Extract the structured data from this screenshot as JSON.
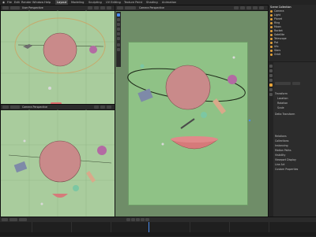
{
  "topbar": {
    "menu": [
      "File",
      "Edit",
      "Render",
      "Window",
      "Help"
    ],
    "workspace_tabs": [
      "Layout",
      "Modeling",
      "Sculpting",
      "UV Editing",
      "Texture Paint",
      "Shading",
      "Animation"
    ]
  },
  "viewports": {
    "top_left": {
      "label": "User Perspective"
    },
    "bottom_left": {
      "label": "Camera Perspective"
    },
    "main": {
      "label": "Camera Perspective"
    }
  },
  "outliner": {
    "items": [
      "Scene Collection",
      "Camera",
      "Light",
      "Planet",
      "Ring",
      "Moon",
      "Rocket",
      "Satellite",
      "Telescope",
      "Pot",
      "Ufo",
      "Stars",
      "Orbit"
    ]
  },
  "properties": {
    "rows": [
      "Transform",
      "Location",
      "Rotation",
      "Scale",
      "Delta Transform",
      "Relations",
      "Collections",
      "Instancing",
      "Motion Paths",
      "Visibility",
      "Viewport Display",
      "Line Art",
      "Custom Properties"
    ]
  },
  "colors": {
    "viewport_bg": "#a9cc9d",
    "planet": "#c98a8a",
    "accent_blue": "#4b8df2",
    "orange_select": "#e6a33a"
  }
}
